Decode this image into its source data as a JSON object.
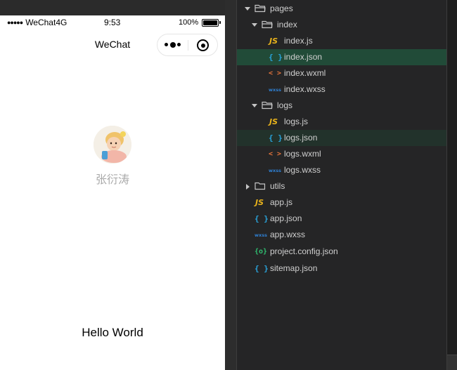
{
  "simulator": {
    "status_bar": {
      "signal_dots": "●●●●●",
      "carrier": "WeChat4G",
      "time": "9:53",
      "battery_percent": "100%"
    },
    "nav_title": "WeChat",
    "user": {
      "nickname": "张衍涛"
    },
    "motto": "Hello World"
  },
  "file_tree": {
    "items": [
      {
        "name": "pages",
        "type": "folder",
        "expanded": true,
        "depth": 0
      },
      {
        "name": "index",
        "type": "folder",
        "expanded": true,
        "depth": 1
      },
      {
        "name": "index.js",
        "type": "js",
        "depth": 2
      },
      {
        "name": "index.json",
        "type": "json",
        "depth": 2,
        "selected": true
      },
      {
        "name": "index.wxml",
        "type": "wxml",
        "depth": 2
      },
      {
        "name": "index.wxss",
        "type": "wxss",
        "depth": 2
      },
      {
        "name": "logs",
        "type": "folder",
        "expanded": true,
        "depth": 1
      },
      {
        "name": "logs.js",
        "type": "js",
        "depth": 2
      },
      {
        "name": "logs.json",
        "type": "json",
        "depth": 2,
        "hovered": true
      },
      {
        "name": "logs.wxml",
        "type": "wxml",
        "depth": 2
      },
      {
        "name": "logs.wxss",
        "type": "wxss",
        "depth": 2
      },
      {
        "name": "utils",
        "type": "folder",
        "expanded": false,
        "depth": 0
      },
      {
        "name": "app.js",
        "type": "js",
        "depth": 1
      },
      {
        "name": "app.json",
        "type": "json",
        "depth": 1
      },
      {
        "name": "app.wxss",
        "type": "wxss",
        "depth": 1
      },
      {
        "name": "project.config.json",
        "type": "config",
        "depth": 1
      },
      {
        "name": "sitemap.json",
        "type": "json",
        "depth": 1
      }
    ],
    "icon_glyphs": {
      "js": "JS",
      "json": "{ }",
      "wxml": "< >",
      "wxss": "wxss",
      "config": "{o}"
    }
  },
  "colors": {
    "selected_row": "#214b38",
    "hover_row": "#22322b",
    "js_icon": "#e8b21b",
    "json_icon": "#29a4dc",
    "wxml_icon": "#e0733b",
    "wxss_icon": "#2f7fd1",
    "config_icon": "#2fbf71"
  }
}
